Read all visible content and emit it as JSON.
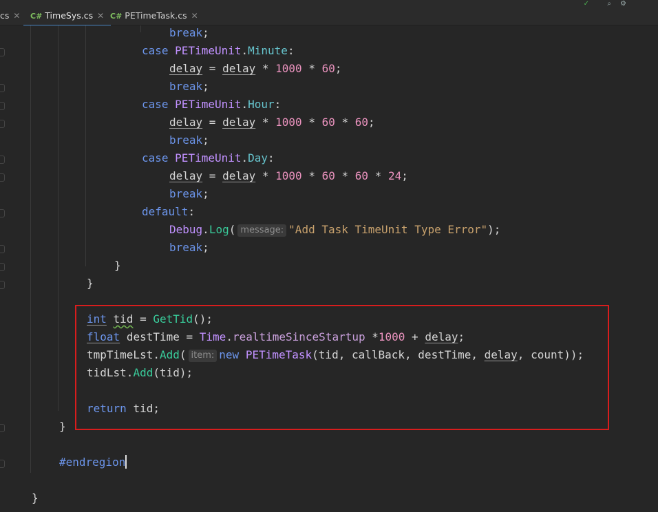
{
  "tabs": [
    {
      "icon": "",
      "name": "cs",
      "active": false
    },
    {
      "icon": "C#",
      "name": "TimeSys.cs",
      "active": true
    },
    {
      "icon": "C#",
      "name": "PETimeTask.cs",
      "active": false
    }
  ],
  "code": {
    "break": "break",
    "case": "case",
    "default": "default",
    "enum_type": "PETimeUnit",
    "minute": "Minute",
    "hour": "Hour",
    "day": "Day",
    "delay": "delay",
    "n1000": "1000",
    "n60": "60",
    "n24": "24",
    "debug": "Debug",
    "log": "Log",
    "hint_message": "message:",
    "error_str": "\"Add Task TimeUnit Type Error\"",
    "int": "int",
    "tid": "tid",
    "gettid": "GetTid",
    "float": "float",
    "desttime": "destTime",
    "time": "Time",
    "realtime": "realtimeSinceStartup",
    "tmplist": "tmpTimeLst",
    "add": "Add",
    "hint_item": "item:",
    "new": "new",
    "petimetask": "PETimeTask",
    "callback": "callBack",
    "count": "count",
    "tidlst": "tidLst",
    "return": "return",
    "endregion": "#endregion"
  }
}
